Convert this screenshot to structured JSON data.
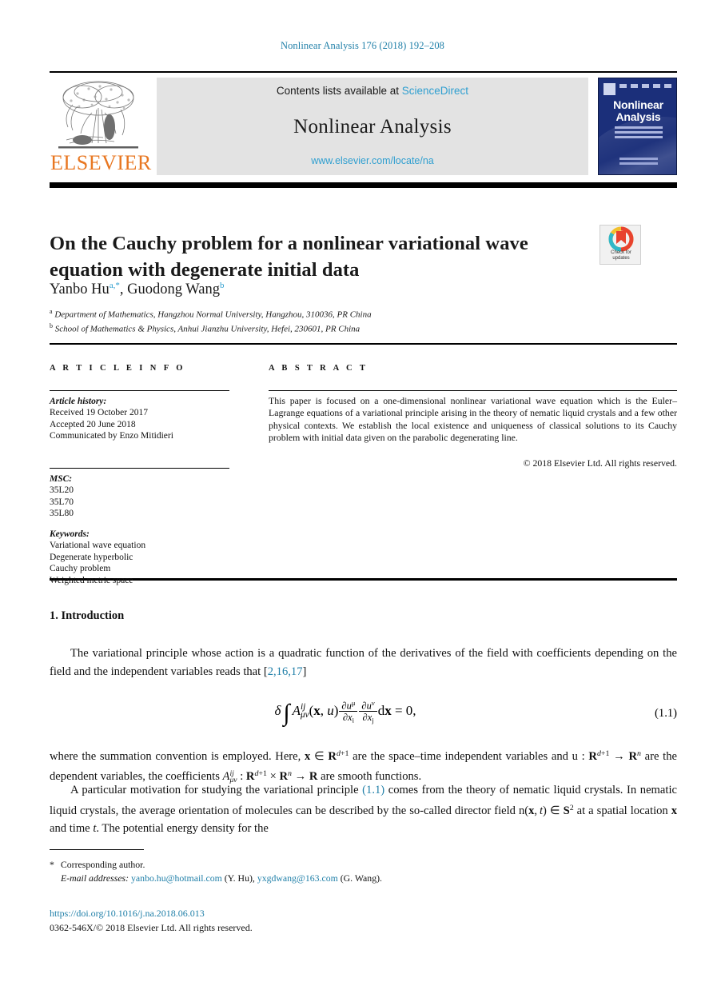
{
  "running_head": "Nonlinear Analysis 176 (2018) 192–208",
  "masthead": {
    "publisher_name": "ELSEVIER",
    "publisher_logo_alt": "elsevier-tree-logo",
    "contents_prefix": "Contents lists available at",
    "contents_link": "ScienceDirect",
    "journal_title": "Nonlinear Analysis",
    "journal_url": "www.elsevier.com/locate/na",
    "cover": {
      "title_line_1": "Nonlinear",
      "title_line_2": "Analysis"
    }
  },
  "article": {
    "title": "On the Cauchy problem for a nonlinear variational wave equation with degenerate initial data",
    "crossmark": {
      "line1": "Check for",
      "line2": "updates"
    },
    "authors": [
      {
        "name": "Yanbo Hu",
        "marks": "a,*"
      },
      {
        "name": "Guodong Wang",
        "marks": "b"
      }
    ],
    "affiliations": [
      {
        "mark": "a",
        "text": "Department of Mathematics, Hangzhou Normal University, Hangzhou, 310036, PR China"
      },
      {
        "mark": "b",
        "text": "School of Mathematics & Physics, Anhui Jianzhu University, Hefei, 230601, PR China"
      }
    ]
  },
  "info_column": {
    "heading": "A R T I C L E   I N F O",
    "history": {
      "label": "Article history:",
      "lines": [
        "Received 19 October 2017",
        "Accepted 20 June 2018",
        "Communicated by Enzo Mitidieri"
      ]
    },
    "msc": {
      "label": "MSC:",
      "codes": [
        "35L20",
        "35L70",
        "35L80"
      ]
    },
    "keywords": {
      "label": "Keywords:",
      "items": [
        "Variational wave equation",
        "Degenerate hyperbolic",
        "Cauchy problem",
        "Weighted metric space"
      ]
    }
  },
  "abstract": {
    "heading": "A B S T R A C T",
    "text": "This paper is focused on a one-dimensional nonlinear variational wave equation which is the Euler–Lagrange equations of a variational principle arising in the theory of nematic liquid crystals and a few other physical contexts. We establish the local existence and uniqueness of classical solutions to its Cauchy problem with initial data given on the parabolic degenerating line.",
    "copyright": "© 2018 Elsevier Ltd. All rights reserved."
  },
  "body": {
    "section_heading": "1. Introduction",
    "paragraph_1_before_ref": "The variational principle whose action is a quadratic function of the derivatives of the field with coefficients depending on the field and the independent variables reads that [",
    "paragraph_1_ref": "2,16,17",
    "paragraph_1_after_ref": "]",
    "equation_number": "(1.1)",
    "equation_plain": "δ ∫ A^{ij}_{μν}(x, u) ∂u^μ/∂x_i ∂u^ν/∂x_j dx = 0,",
    "paragraph_2": "where the summation convention is employed. Here, x ∈ R^{d+1} are the space–time independent variables and u : R^{d+1} → R^n are the dependent variables, the coefficients A^{ij}_{μν} : R^{d+1} × R^n → R are smooth functions.",
    "paragraph_3_a": "A particular motivation for studying the variational principle ",
    "paragraph_3_ref": "(1.1)",
    "paragraph_3_b": " comes from the theory of nematic liquid crystals. In nematic liquid crystals, the average orientation of molecules can be described by the so-called director field n(x, t) ∈ S² at a spatial location x and time t. The potential energy density for the"
  },
  "footer": {
    "corresponding_marker": "*",
    "corresponding_author": "Corresponding author.",
    "email_label": "E-mail addresses:",
    "email_1": "yanbo.hu@hotmail.com",
    "email_1_owner": "(Y. Hu),",
    "email_2": "yxgdwang@163.com",
    "email_2_owner": "(G. Wang).",
    "doi": "https://doi.org/10.1016/j.na.2018.06.013",
    "issn_line": "0362-546X/© 2018 Elsevier Ltd. All rights reserved."
  },
  "colors": {
    "link_blue": "#1f7fa8",
    "sciencedirect_blue": "#2f9fd0",
    "elsevier_orange": "#e87722",
    "cover_navy": "#1b2f7a",
    "box_grey": "#e3e3e3"
  }
}
